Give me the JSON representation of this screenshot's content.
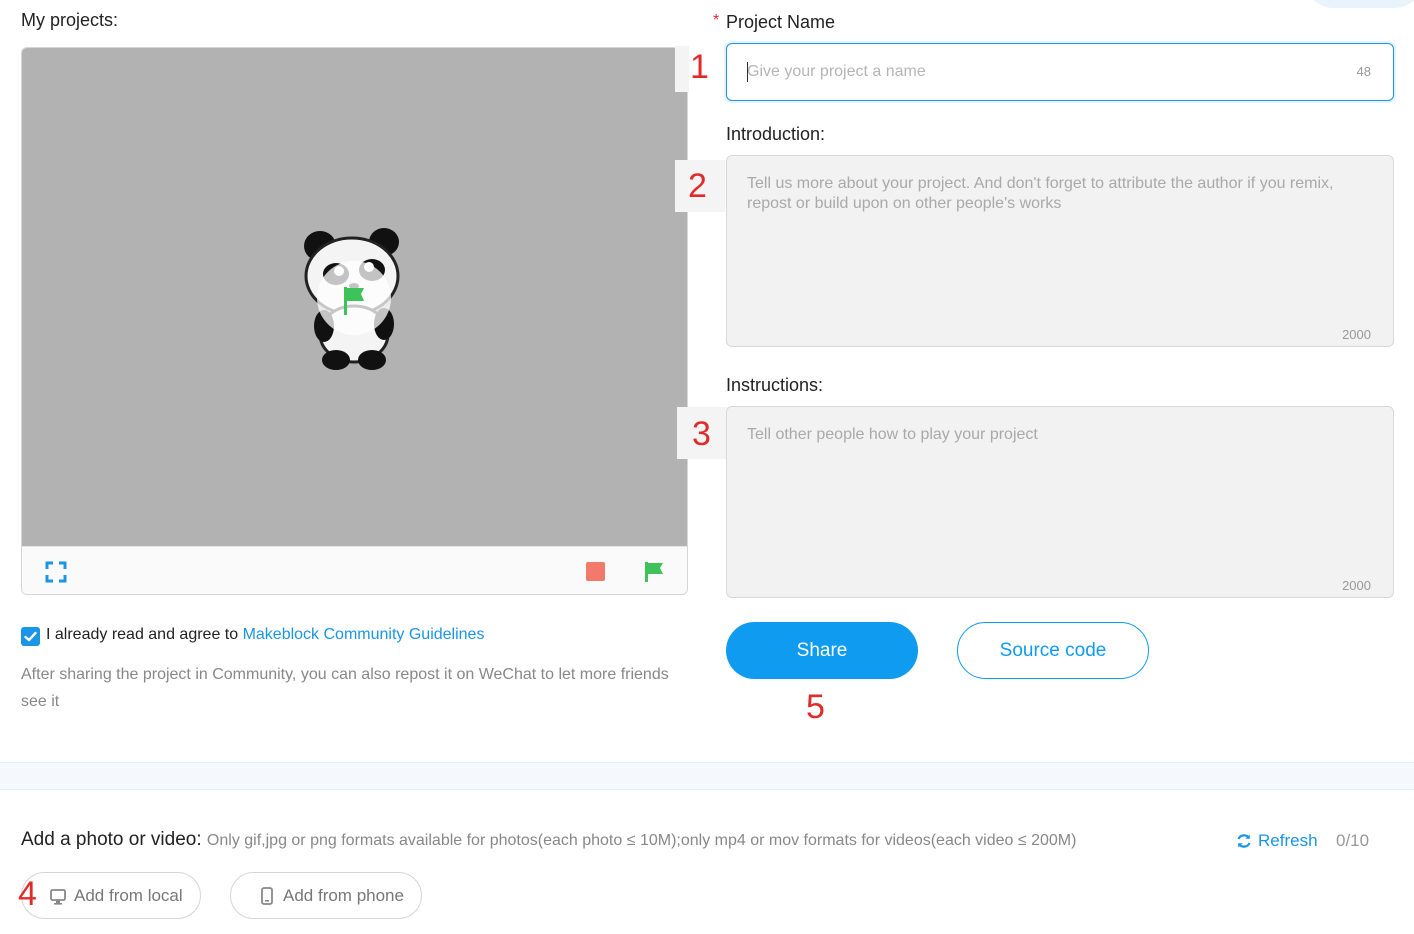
{
  "left": {
    "projects_label": "My projects:",
    "agree": {
      "checked": true,
      "text": "I already read and agree to ",
      "link": "Makeblock Community Guidelines"
    },
    "hint": "After sharing the project in Community, you can also repost it on WeChat to let more friends see it"
  },
  "form": {
    "required_mark": "*",
    "name_label": "Project Name",
    "name_placeholder": "Give your project a name",
    "name_counter": "48",
    "intro_label": "Introduction:",
    "intro_placeholder": "Tell us more about your project. And don't forget to attribute the author if you remix, repost or build upon on other people's works",
    "intro_counter": "2000",
    "instructions_label": "Instructions:",
    "instructions_placeholder": "Tell other people how to play your project",
    "instructions_counter": "2000",
    "share_label": "Share",
    "source_label": "Source code"
  },
  "media": {
    "title": "Add a photo or video:",
    "desc": "Only gif,jpg or png formats available for photos(each photo ≤ 10M);only mp4 or mov formats for videos(each video ≤ 200M)",
    "refresh_label": "Refresh",
    "count": "0/10",
    "add_local_label": "Add from local",
    "add_phone_label": "Add from phone"
  },
  "annotations": [
    "1",
    "2",
    "3",
    "4",
    "5"
  ],
  "colors": {
    "accent": "#0f9bf0",
    "stage_bg": "#b2b2b2",
    "stop": "#f27a6b",
    "flag": "#3ec25a",
    "annotation": "#e02b2b"
  },
  "icons": [
    "fullscreen-icon",
    "stop-icon",
    "green-flag-icon",
    "play-icon",
    "checkmark-icon",
    "refresh-icon",
    "monitor-icon",
    "phone-icon"
  ]
}
